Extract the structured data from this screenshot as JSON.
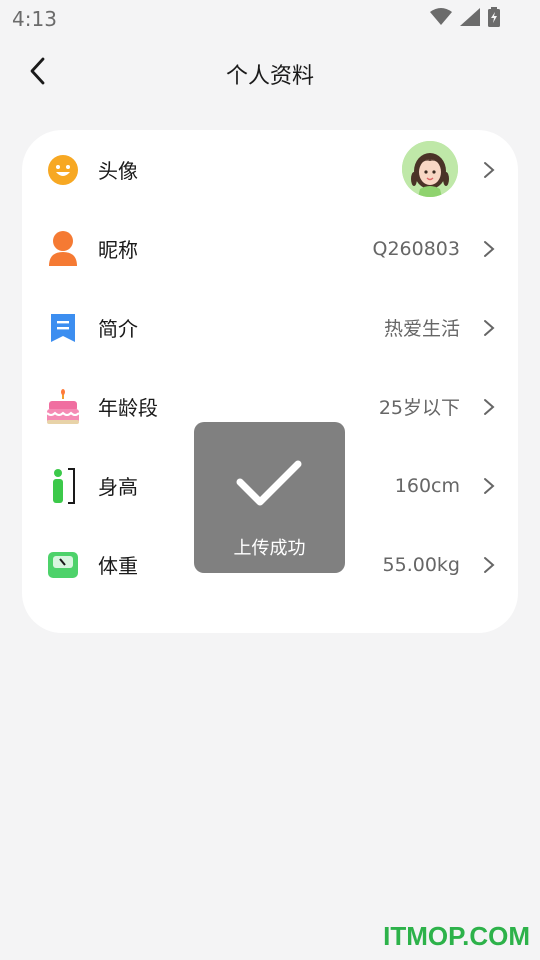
{
  "status_bar": {
    "time": "4:13",
    "icons": [
      "wifi-icon",
      "signal-icon",
      "battery-charging-icon"
    ]
  },
  "header": {
    "title": "个人资料",
    "back_icon": "chevron-left-icon"
  },
  "profile_rows": [
    {
      "label": "头像",
      "value": "",
      "icon": "smiley-face-icon",
      "icon_color": "#f7a823",
      "avatar": true
    },
    {
      "label": "昵称",
      "value": "Q260803",
      "icon": "person-icon",
      "icon_color": "#f57a33"
    },
    {
      "label": "简介",
      "value": "热爱生活",
      "icon": "bookmark-note-icon",
      "icon_color": "#3c8ef0"
    },
    {
      "label": "年龄段",
      "value": "25岁以下",
      "icon": "birthday-cake-icon",
      "icon_color": "#f06ea0"
    },
    {
      "label": "身高",
      "value": "160cm",
      "icon": "height-person-icon",
      "icon_color": "#3cc94a"
    },
    {
      "label": "体重",
      "value": "55.00kg",
      "icon": "weight-scale-icon",
      "icon_color": "#4dd26a"
    }
  ],
  "toast": {
    "text": "上传成功",
    "icon": "checkmark-icon"
  },
  "watermark": {
    "text": "ITMOP.COM",
    "color": "#2db24a"
  }
}
